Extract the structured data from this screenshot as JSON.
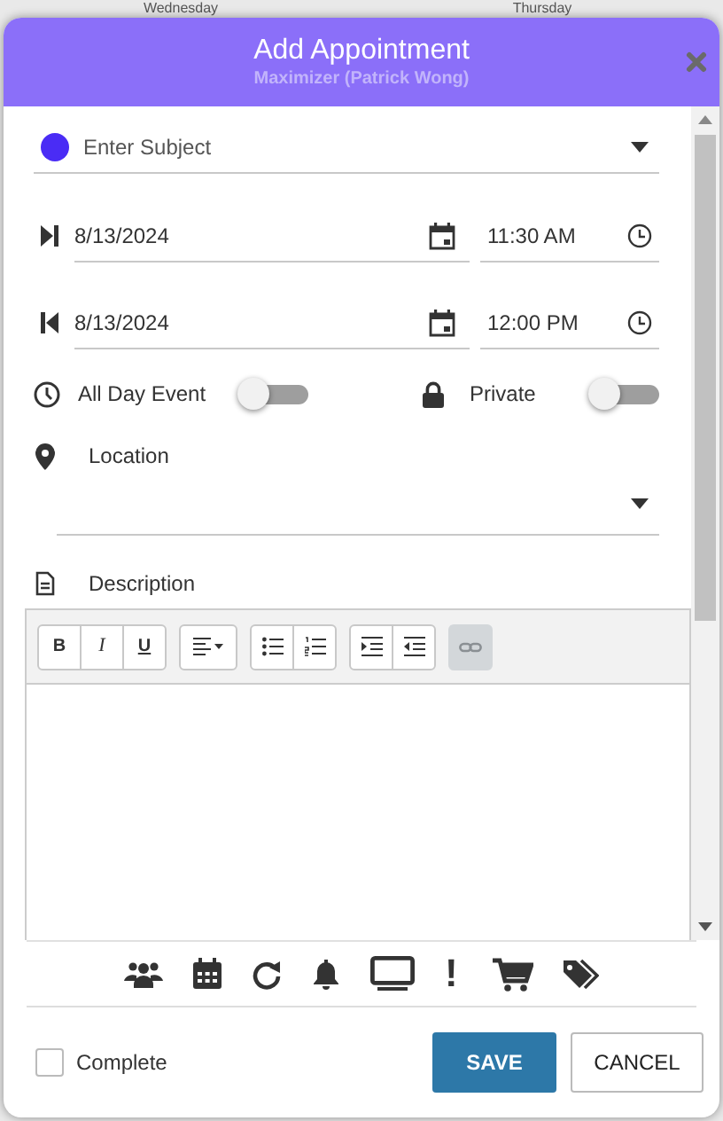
{
  "background": {
    "column_headers": [
      "Wednesday",
      "Thursday"
    ]
  },
  "dialog": {
    "title": "Add Appointment",
    "subtitle": "Maximizer (Patrick Wong)",
    "subject": {
      "placeholder": "Enter Subject",
      "color": "#4a2cf5"
    },
    "start": {
      "date": "8/13/2024",
      "time": "11:30 AM"
    },
    "end": {
      "date": "8/13/2024",
      "time": "12:00 PM"
    },
    "all_day": {
      "label": "All Day Event",
      "on": false
    },
    "private": {
      "label": "Private",
      "on": false
    },
    "location": {
      "label": "Location"
    },
    "description": {
      "label": "Description"
    },
    "editor_toolbar": [
      [
        {
          "kind": "bold",
          "label": "B",
          "disabled": false
        },
        {
          "kind": "italic",
          "label": "I",
          "disabled": false
        },
        {
          "kind": "underline",
          "label": "U",
          "disabled": false
        }
      ],
      [
        {
          "kind": "align",
          "disabled": false
        }
      ],
      [
        {
          "kind": "bullets",
          "disabled": false
        },
        {
          "kind": "numbers",
          "disabled": false
        }
      ],
      [
        {
          "kind": "indent",
          "disabled": false
        },
        {
          "kind": "outdent",
          "disabled": false
        }
      ],
      [
        {
          "kind": "link",
          "disabled": true
        }
      ]
    ],
    "bottom_toolbar": [
      {
        "kind": "people"
      },
      {
        "kind": "calendar"
      },
      {
        "kind": "repeat"
      },
      {
        "kind": "bell"
      },
      {
        "kind": "monitor"
      },
      {
        "kind": "text",
        "label": "!"
      },
      {
        "kind": "cart"
      },
      {
        "kind": "tags"
      }
    ],
    "complete": {
      "label": "Complete",
      "checked": false
    },
    "buttons": [
      {
        "kind": "primary",
        "label": "SAVE"
      },
      {
        "kind": "secondary",
        "label": "CANCEL"
      }
    ]
  }
}
